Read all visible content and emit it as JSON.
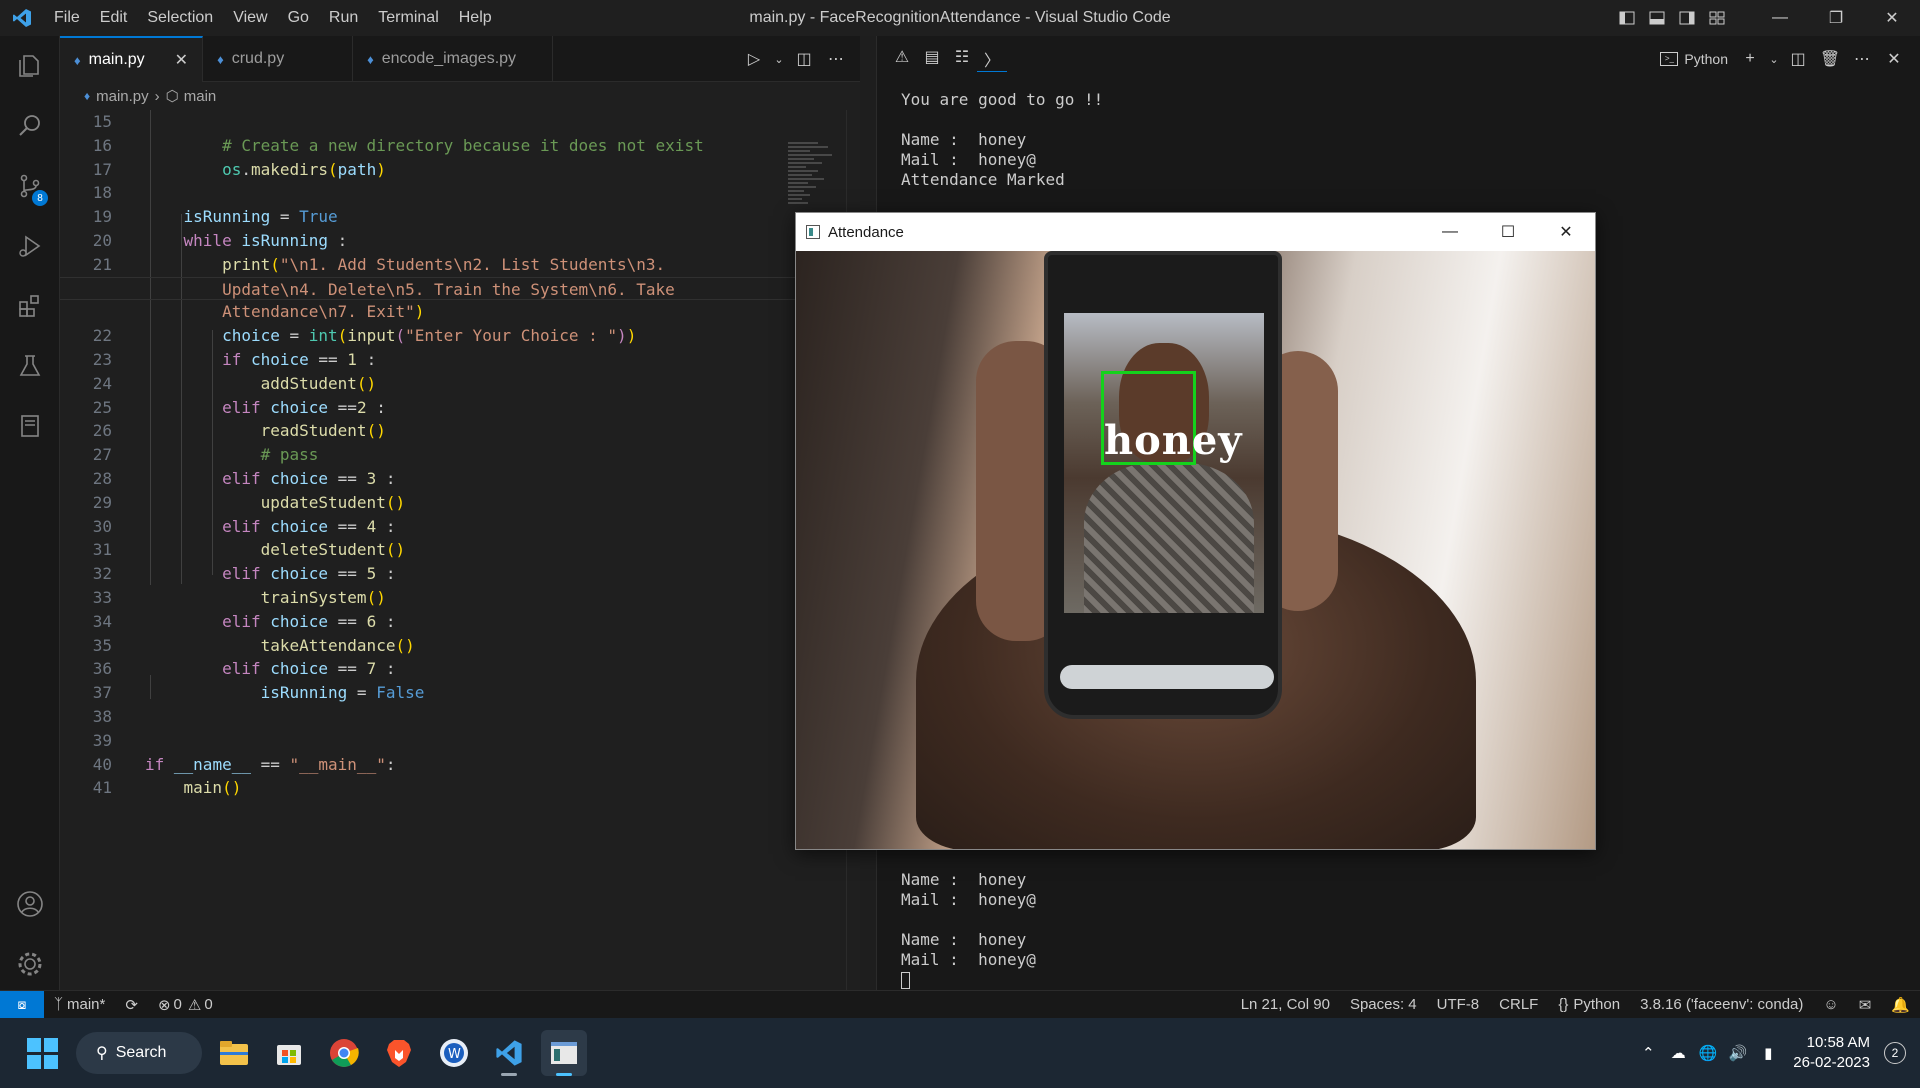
{
  "window": {
    "title": "main.py - FaceRecognitionAttendance - Visual Studio Code",
    "menu": [
      "File",
      "Edit",
      "Selection",
      "View",
      "Go",
      "Run",
      "Terminal",
      "Help"
    ]
  },
  "activity": {
    "source_control_badge": "8"
  },
  "tabs": [
    {
      "label": "main.py",
      "active": true
    },
    {
      "label": "crud.py",
      "active": false
    },
    {
      "label": "encode_images.py",
      "active": false
    }
  ],
  "breadcrumb": {
    "file": "main.py",
    "symbol": "main"
  },
  "code": {
    "line_numbers": [
      "15",
      "16",
      "17",
      "18",
      "19",
      "20",
      "21",
      "",
      "",
      "22",
      "23",
      "24",
      "25",
      "26",
      "27",
      "28",
      "29",
      "30",
      "31",
      "32",
      "33",
      "34",
      "35",
      "36",
      "37",
      "38",
      "39",
      "40",
      "41"
    ]
  },
  "terminal": {
    "shell": "Python",
    "top_lines": [
      "You are good to go !!",
      "",
      "Name :  honey",
      "Mail :  honey@",
      "Attendance Marked"
    ],
    "bottom_lines": [
      "Name :  honey",
      "Mail :  honey@",
      "",
      "Name :  honey",
      "Mail :  honey@"
    ]
  },
  "camera_window": {
    "title": "Attendance",
    "detected_name": "honey"
  },
  "statusbar": {
    "branch": "main*",
    "errors": "0",
    "warnings": "0",
    "position": "Ln 21, Col 90",
    "spaces": "Spaces: 4",
    "encoding": "UTF-8",
    "eol": "CRLF",
    "language": "Python",
    "interpreter": "3.8.16 ('faceenv': conda)"
  },
  "taskbar": {
    "search": "Search",
    "time": "10:58 AM",
    "date": "26-02-2023",
    "notifications": "2"
  },
  "colors": {
    "accent": "#0078d4",
    "detection_box": "#14d21c"
  }
}
